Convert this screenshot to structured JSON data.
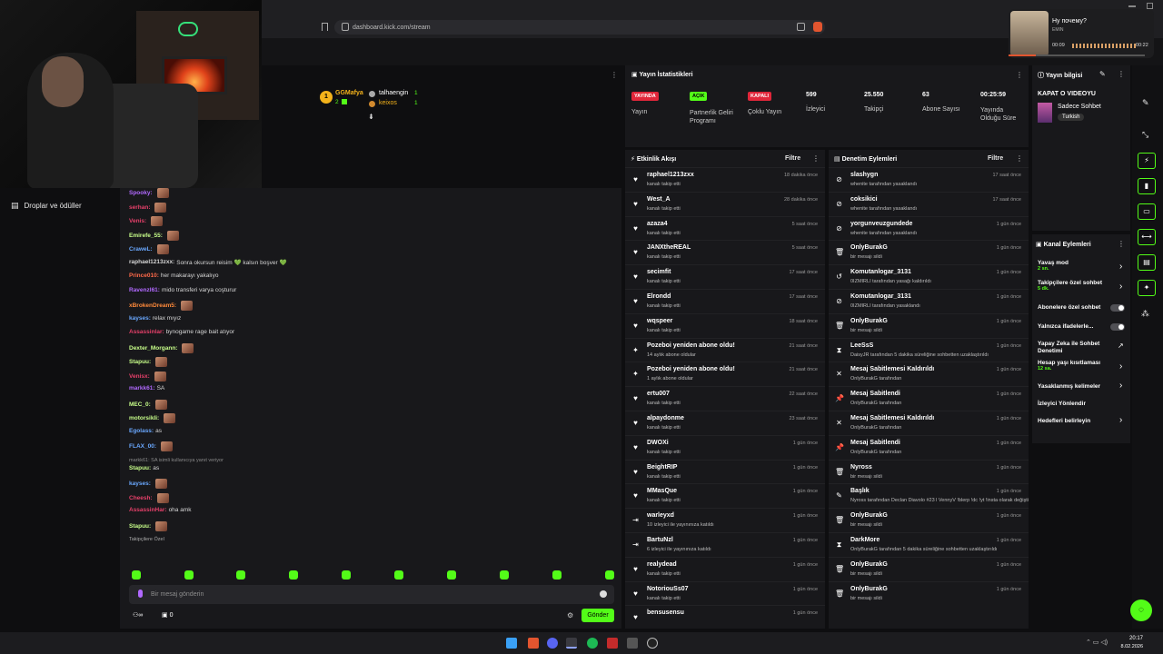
{
  "browser": {
    "url": "dashboard.kick.com/stream"
  },
  "player": {
    "title": "Ну почему?",
    "artist": "EMIN",
    "time_elapsed": "00:09",
    "time_total": "00:22"
  },
  "leftnav": {
    "item1": "Droplar ve ödüller"
  },
  "leaderboard": {
    "first_name": "GGMafya",
    "first_count": "2",
    "second_name": "talhaengin",
    "second_count": "1",
    "third_name": "keixos",
    "third_count": "1",
    "rank": "1"
  },
  "chat": {
    "messages": [
      {
        "user": "Spooky:",
        "text": "",
        "color": "#b169ff",
        "emote": true
      },
      {
        "user": "serhan:",
        "text": "",
        "color": "#e6406a",
        "emote": true
      },
      {
        "user": "Venis:",
        "text": "",
        "color": "#e6406a",
        "emote": true
      },
      {
        "user": "Emirefe_55:",
        "text": "",
        "color": "#c8ff8a",
        "emote": true
      },
      {
        "user": "CraweL:",
        "text": "",
        "color": "#6aa8ff",
        "emote": true
      },
      {
        "user": "raphael1213zxx:",
        "text": "Sonra okursun reisim 💚 kalsın boşver 💚",
        "color": "#d7d7d7",
        "emote": false
      },
      {
        "user": "Prince010:",
        "text": "her makarayı yakalıyo",
        "color": "#ff6a4a",
        "emote": false
      },
      {
        "user": "Ravenzl61:",
        "text": "mido transferi varya coşturur",
        "color": "#b169ff",
        "emote": false
      },
      {
        "user": "xBrokenDream5:",
        "text": "",
        "color": "#ff8a3a",
        "emote": true
      },
      {
        "user": "kayses:",
        "text": "relax mıyız",
        "color": "#6aa8ff",
        "emote": false
      },
      {
        "user": "Assassinlar:",
        "text": "bynogame rage bait atıyor",
        "color": "#e6406a",
        "emote": false
      },
      {
        "user": "Dexter_Morgann:",
        "text": "",
        "color": "#c8ff8a",
        "emote": true
      },
      {
        "user": "Stapuu:",
        "text": "",
        "color": "#c8ff8a",
        "emote": true
      },
      {
        "user": "Venisx:",
        "text": "",
        "color": "#e6406a",
        "emote": true
      },
      {
        "user": "markk61:",
        "text": "SA",
        "color": "#b169ff",
        "emote": false
      },
      {
        "user": "MEC_0:",
        "text": "",
        "color": "#c8ff8a",
        "emote": true
      },
      {
        "user": "motorsikli:",
        "text": "",
        "color": "#c8ff8a",
        "emote": true
      },
      {
        "user": "Egolass:",
        "text": "as",
        "color": "#6aa8ff",
        "emote": false
      },
      {
        "user": "FLAX_00:",
        "text": "",
        "color": "#6aa8ff",
        "emote": true
      }
    ],
    "reply_note": "markk61: SA isimli kullanıcıya yanıt veriyor",
    "messages2": [
      {
        "user": "Stapuu:",
        "text": "as",
        "color": "#c8ff8a"
      },
      {
        "user": "kayses:",
        "text": "",
        "color": "#6aa8ff"
      },
      {
        "user": "Cheesh:",
        "text": "",
        "color": "#e6406a"
      },
      {
        "user": "AssassinHar:",
        "text": "oha amk",
        "color": "#e6406a"
      },
      {
        "user": "Stapuu:",
        "text": "",
        "color": "#c8ff8a"
      }
    ],
    "followers_label": "Takipçilere Özel",
    "input_placeholder": "Bir mesaj gönderin",
    "send": "Gönder",
    "bottom_count1": "∞",
    "bottom_count2": "0"
  },
  "stats": {
    "title": "Yayın İstatistikleri",
    "tag1": "YAYINDA",
    "label1": "Yayın",
    "tag2": "AÇIK",
    "label2": "Partnerlik Geliri Programı",
    "tag3": "KAPALI",
    "label3": "Çoklu Yayın",
    "viewers": "599",
    "viewers_label": "İzleyici",
    "followers": "25.550",
    "followers_label": "Takipçi",
    "subs": "63",
    "subs_label": "Abone Sayısı",
    "uptime": "00:25:59",
    "uptime_label": "Yayında Olduğu Süre"
  },
  "info": {
    "title": "Yayın bilgisi",
    "stream_title": "KAPAT O VIDEOYU",
    "category": "Sadece Sohbet",
    "language": "Turkish"
  },
  "activity": {
    "title": "Etkinlik Akışı",
    "filter": "Filtre",
    "rows": [
      {
        "name": "raphael1213zxx",
        "desc": "kanalı takip etti",
        "time": "18 dakika önce",
        "icon": "♥"
      },
      {
        "name": "West_A",
        "desc": "kanalı takip etti",
        "time": "28 dakika önce",
        "icon": "♥"
      },
      {
        "name": "azaza4",
        "desc": "kanalı takip etti",
        "time": "5 saat önce",
        "icon": "♥"
      },
      {
        "name": "JANXtheREAL",
        "desc": "kanalı takip etti",
        "time": "5 saat önce",
        "icon": "♥"
      },
      {
        "name": "secimfit",
        "desc": "kanalı takip etti",
        "time": "17 saat önce",
        "icon": "♥"
      },
      {
        "name": "Elrondd",
        "desc": "kanalı takip etti",
        "time": "17 saat önce",
        "icon": "♥"
      },
      {
        "name": "wqspeer",
        "desc": "kanalı takip etti",
        "time": "18 saat önce",
        "icon": "♥"
      },
      {
        "name": "Pozeboi yeniden abone oldu!",
        "desc": "14 aylık abone oldular",
        "time": "21 saat önce",
        "icon": "✦"
      },
      {
        "name": "Pozeboi yeniden abone oldu!",
        "desc": "1 aylık abone oldular",
        "time": "21 saat önce",
        "icon": "✦"
      },
      {
        "name": "ertu007",
        "desc": "kanalı takip etti",
        "time": "22 saat önce",
        "icon": "♥"
      },
      {
        "name": "alpaydonme",
        "desc": "kanalı takip etti",
        "time": "23 saat önce",
        "icon": "♥"
      },
      {
        "name": "DWOXi",
        "desc": "kanalı takip etti",
        "time": "1 gün önce",
        "icon": "♥"
      },
      {
        "name": "BeightRIP",
        "desc": "kanalı takip etti",
        "time": "1 gün önce",
        "icon": "♥"
      },
      {
        "name": "MMasQue",
        "desc": "kanalı takip etti",
        "time": "1 gün önce",
        "icon": "♥"
      },
      {
        "name": "warleyxd",
        "desc": "10 izleyici ile yayınınıza katıldı",
        "time": "1 gün önce",
        "icon": "⇥"
      },
      {
        "name": "BartuNzl",
        "desc": "6 izleyici ile yayınınıza katıldı",
        "time": "1 gün önce",
        "icon": "⇥"
      },
      {
        "name": "realydead",
        "desc": "kanalı takip etti",
        "time": "1 gün önce",
        "icon": "♥"
      },
      {
        "name": "NotoriouSs07",
        "desc": "kanalı takip etti",
        "time": "1 gün önce",
        "icon": "♥"
      },
      {
        "name": "bensusensu",
        "desc": "",
        "time": "1 gün önce",
        "icon": "♥"
      }
    ]
  },
  "moderation": {
    "title": "Denetim Eylemleri",
    "filter": "Filtre",
    "rows": [
      {
        "name": "slashygn",
        "desc": "whenite tarafından yasaklandı",
        "time": "17 saat önce",
        "icon": "⊘"
      },
      {
        "name": "coksikici",
        "desc": "whenite tarafından yasaklandı",
        "time": "17 saat önce",
        "icon": "⊘"
      },
      {
        "name": "yorgunveuzgundede",
        "desc": "whenite tarafından yasaklandı",
        "time": "1 gün önce",
        "icon": "⊘"
      },
      {
        "name": "OnlyBurakG",
        "desc": "bir mesajı sildi",
        "time": "1 gün önce",
        "icon": "🗑"
      },
      {
        "name": "Komutanlogar_3131",
        "desc": "0IZMIRLI tarafından yasağı kaldırıldı",
        "time": "1 gün önce",
        "icon": "↺"
      },
      {
        "name": "Komutanlogar_3131",
        "desc": "0IZMIRLI tarafından yasaklandı",
        "time": "1 gün önce",
        "icon": "⊘"
      },
      {
        "name": "OnlyBurakG",
        "desc": "bir mesajı sildi",
        "time": "1 gün önce",
        "icon": "🗑"
      },
      {
        "name": "LeeSsS",
        "desc": "DaisyJR tarafından 5 dakika süreliğine sohbetten uzaklaştırıldı",
        "time": "1 gün önce",
        "icon": "⧗"
      },
      {
        "name": "Mesaj Sabitlemesi Kaldırıldı",
        "desc": "OnlyBurakG tarafından",
        "time": "1 gün önce",
        "icon": "✕"
      },
      {
        "name": "Mesaj Sabitlendi",
        "desc": "OnlyBurakG tarafından",
        "time": "1 gün önce",
        "icon": "📌"
      },
      {
        "name": "Mesaj Sabitlemesi Kaldırıldı",
        "desc": "OnlyBurakG tarafından",
        "time": "1 gün önce",
        "icon": "✕"
      },
      {
        "name": "Mesaj Sabitlendi",
        "desc": "OnlyBurakG tarafından",
        "time": "1 gün önce",
        "icon": "📌"
      },
      {
        "name": "Nyross",
        "desc": "bir mesajı sildi",
        "time": "1 gün önce",
        "icon": "🗑"
      },
      {
        "name": "Başlık",
        "desc": "Nyross tarafından Declan Diavolo #23 l VennyV !blerp !dc !yt !insta olarak değiştirildi",
        "time": "1 gün önce",
        "icon": "✎"
      },
      {
        "name": "OnlyBurakG",
        "desc": "bir mesajı sildi",
        "time": "1 gün önce",
        "icon": "🗑"
      },
      {
        "name": "DarkMore",
        "desc": "OnlyBurakG tarafından 5 dakika süreliğine sohbetten uzaklaştırıldı",
        "time": "1 gün önce",
        "icon": "⧗"
      },
      {
        "name": "OnlyBurakG",
        "desc": "bir mesajı sildi",
        "time": "1 gün önce",
        "icon": "🗑"
      },
      {
        "name": "OnlyBurakG",
        "desc": "bir mesajı sildi",
        "time": "1 gün önce",
        "icon": "🗑"
      }
    ]
  },
  "channel": {
    "title": "Kanal Eylemleri",
    "slow": "Yavaş mod",
    "slow_val": "2 sn.",
    "followers": "Takipçilere özel sohbet",
    "followers_val": "5 dk.",
    "subs": "Abonelere özel sohbet",
    "emote": "Yalnızca ifadelerle...",
    "ai": "Yapay Zeka ile Sohbet Denetimi",
    "age": "Hesap yaşı kısıtlaması",
    "age_val": "12 sa.",
    "words": "Yasaklanmış kelimeler",
    "raid": "İzleyici Yönlendir",
    "goals": "Hedefleri belirleyin"
  },
  "clock": {
    "time": "20:17",
    "date": "8.02.2026"
  }
}
